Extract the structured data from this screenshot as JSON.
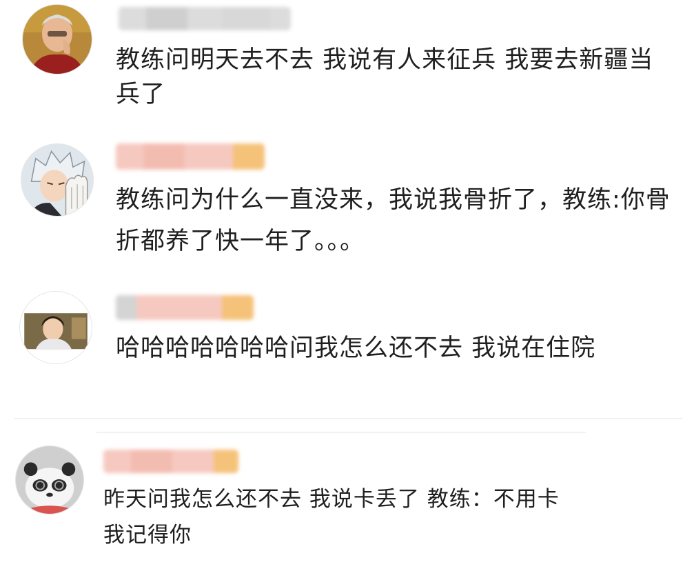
{
  "comments": [
    {
      "text": "教练问明天去不去  我说有人来征兵  我要去新疆当兵了",
      "avatar_icon": "elderly-woman-avatar-icon",
      "username_blurred": true
    },
    {
      "text": "教练问为什么一直没来，我说我骨折了，教练:你骨折都养了快一年了。。。",
      "avatar_icon": "anime-character-avatar-icon",
      "username_blurred": true
    },
    {
      "text": "哈哈哈哈哈哈哈问我怎么还不去 我说在住院",
      "avatar_icon": "girl-photo-avatar-icon",
      "username_blurred": true
    },
    {
      "text": "昨天问我怎么还不去 我说卡丢了 教练：不用卡 我记得你",
      "avatar_icon": "panda-avatar-icon",
      "username_blurred": true
    }
  ],
  "colors": {
    "username_blur_pink": "#f6c9c0",
    "username_blur_gray": "#d4d4d4",
    "username_blur_orange": "#f5c27a",
    "text": "#1f1f1f",
    "divider": "#f1f1f1"
  }
}
